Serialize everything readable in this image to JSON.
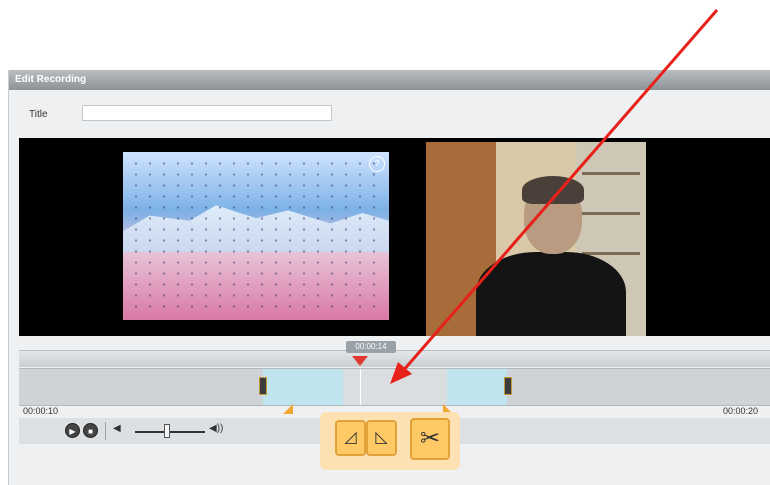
{
  "window": {
    "title": "Edit Recording"
  },
  "title_field": {
    "label": "Title",
    "value": "",
    "placeholder": ""
  },
  "timeline": {
    "current_time": "00:00:14",
    "start_time": "00:00:10",
    "end_time": "00:00:20"
  },
  "screen": {
    "badge": "?"
  },
  "controls": {
    "play_icon": "play-icon",
    "stop_icon": "stop-icon",
    "volume_low": "◀",
    "volume_high": "◀))"
  },
  "edit_tools": {
    "mark_in": "◿",
    "mark_out": "◺",
    "cut": "✂"
  },
  "colors": {
    "accent": "#ffc965",
    "playhead": "#e23a30",
    "clip": "#a8dbe9",
    "annotation_arrow": "#e8201a"
  }
}
